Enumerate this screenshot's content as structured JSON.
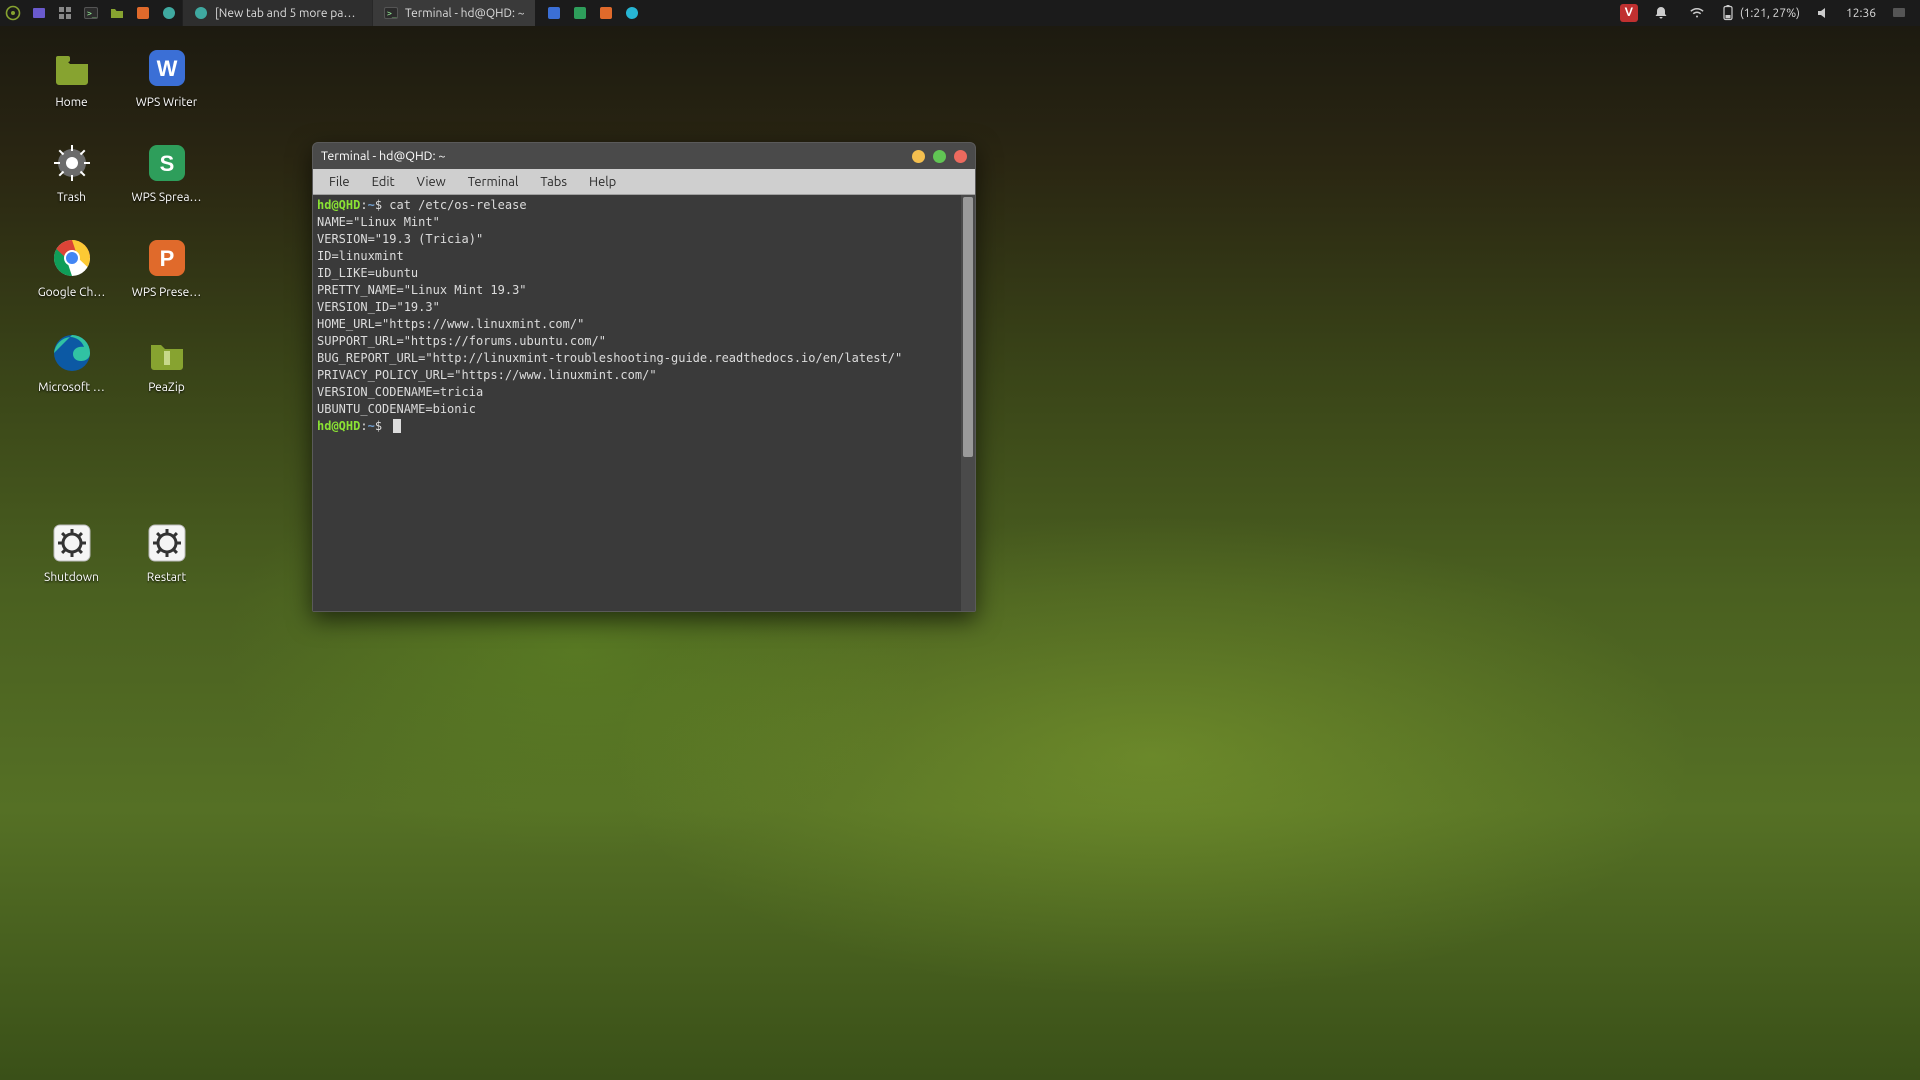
{
  "panel": {
    "taskbar": [
      {
        "label": "[New tab and 5 more page…",
        "icon": "browser-icon",
        "active": false
      },
      {
        "label": "Terminal - hd@QHD: ~",
        "icon": "terminal-icon",
        "active": true
      }
    ],
    "tray": {
      "vivaldi": "V",
      "battery_text": "(1:21, 27%)",
      "clock": "12:36"
    }
  },
  "desktop_icons": [
    [
      {
        "name": "home",
        "label": "Home",
        "color": "#87a330",
        "glyph": "folder"
      },
      {
        "name": "wps-writer",
        "label": "WPS Writer",
        "color": "#3b6fd6",
        "glyph": "W"
      }
    ],
    [
      {
        "name": "trash",
        "label": "Trash",
        "color": "#6b6b6b",
        "glyph": "gear"
      },
      {
        "name": "wps-spread",
        "label": "WPS Sprea…",
        "color": "#2e9e5b",
        "glyph": "S"
      }
    ],
    [
      {
        "name": "google-chrome",
        "label": "Google Ch…",
        "color": "#ffffff",
        "glyph": "chrome"
      },
      {
        "name": "wps-present",
        "label": "WPS Prese…",
        "color": "#e06a2b",
        "glyph": "P"
      }
    ],
    [
      {
        "name": "microsoft-edge",
        "label": "Microsoft …",
        "color": "#ffffff",
        "glyph": "edge"
      },
      {
        "name": "peazip",
        "label": "PeaZip",
        "color": "#87a330",
        "glyph": "archive"
      }
    ],
    [
      {
        "name": "shutdown",
        "label": "Shutdown",
        "color": "#f0f0f0",
        "glyph": "gear-dark"
      },
      {
        "name": "restart",
        "label": "Restart",
        "color": "#f0f0f0",
        "glyph": "gear-dark"
      }
    ]
  ],
  "terminal": {
    "title": "Terminal - hd@QHD: ~",
    "menu": [
      "File",
      "Edit",
      "View",
      "Terminal",
      "Tabs",
      "Help"
    ],
    "prompt": {
      "user_host": "hd@QHD",
      "path": "~",
      "sep": ":",
      "dollar": "$"
    },
    "command": "cat /etc/os-release",
    "output_lines": [
      "NAME=\"Linux Mint\"",
      "VERSION=\"19.3 (Tricia)\"",
      "ID=linuxmint",
      "ID_LIKE=ubuntu",
      "PRETTY_NAME=\"Linux Mint 19.3\"",
      "VERSION_ID=\"19.3\"",
      "HOME_URL=\"https://www.linuxmint.com/\"",
      "SUPPORT_URL=\"https://forums.ubuntu.com/\"",
      "BUG_REPORT_URL=\"http://linuxmint-troubleshooting-guide.readthedocs.io/en/latest/\"",
      "PRIVACY_POLICY_URL=\"https://www.linuxmint.com/\"",
      "VERSION_CODENAME=tricia",
      "UBUNTU_CODENAME=bionic"
    ]
  }
}
